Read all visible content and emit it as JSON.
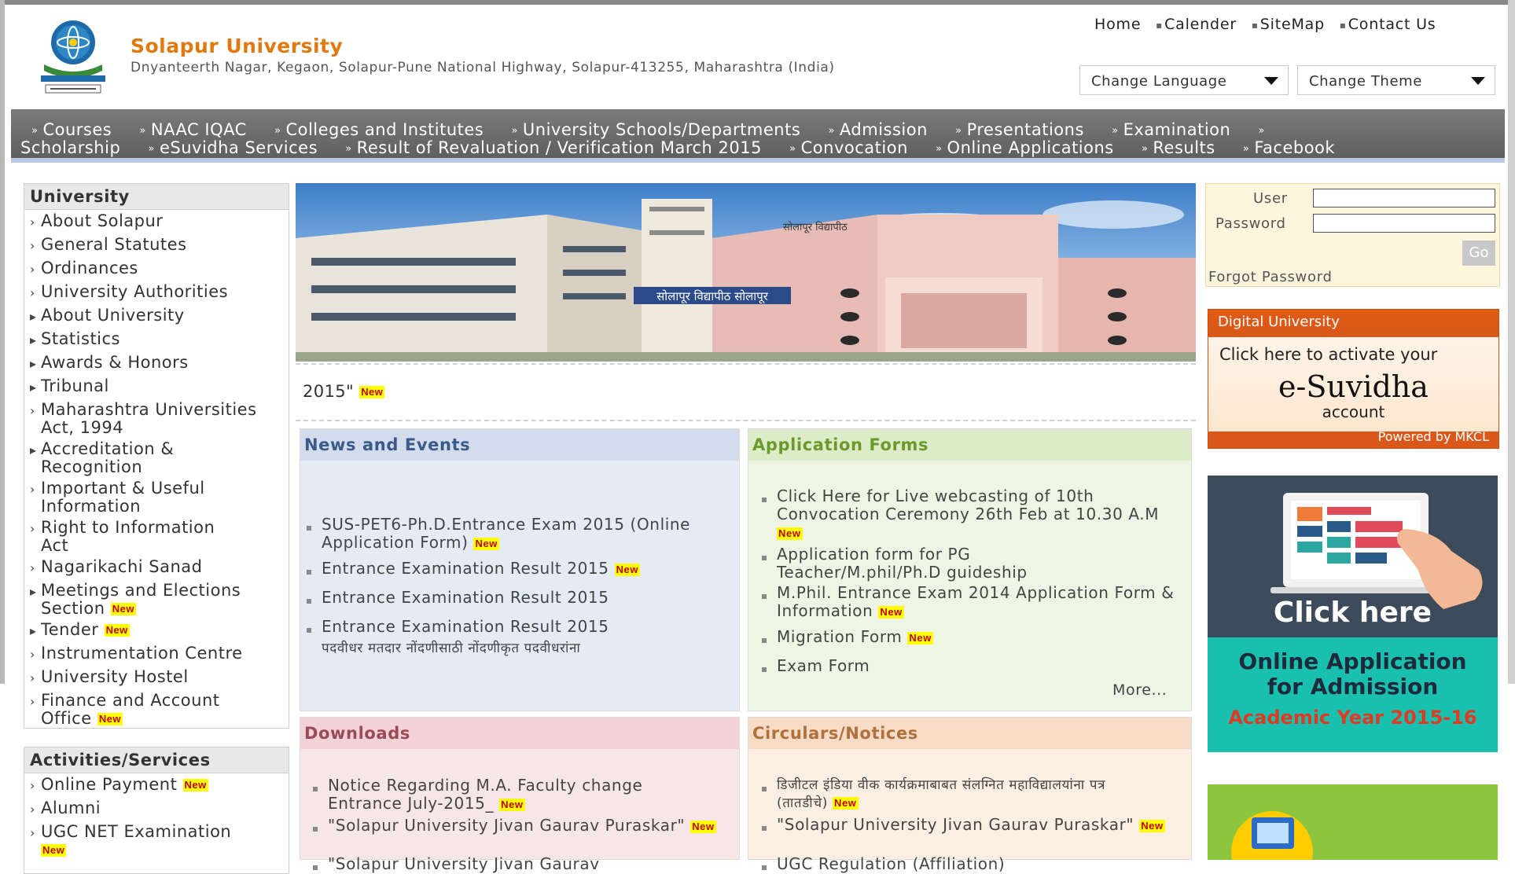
{
  "header": {
    "title": "Solapur University",
    "address": "Dnyanteerth Nagar, Kegaon, Solapur-Pune National Highway, Solapur-413255, Maharashtra (India)",
    "top_links": [
      "Home",
      "Calender",
      "SiteMap",
      "Contact Us"
    ],
    "language_select": "Change Language",
    "theme_select": "Change Theme"
  },
  "nav": {
    "row1": [
      "Courses",
      "NAAC IQAC",
      "Colleges and Institutes",
      "University Schools/Departments",
      "Admission",
      "Presentations",
      "Examination"
    ],
    "row1_tail": "Scholarship",
    "row2": [
      "eSuvidha Services",
      "Result of Revaluation / Verification March 2015",
      "Convocation",
      "Online Applications",
      "Results",
      "Facebook"
    ]
  },
  "sidebar_university": {
    "heading": "University",
    "items": [
      {
        "label": "About Solapur",
        "marker": "›"
      },
      {
        "label": "General Statutes",
        "marker": "›"
      },
      {
        "label": "Ordinances",
        "marker": "›"
      },
      {
        "label": "University Authorities",
        "marker": "›"
      },
      {
        "label": "About University",
        "marker": "▸"
      },
      {
        "label": "Statistics",
        "marker": "▸"
      },
      {
        "label": "Awards & Honors",
        "marker": "▸"
      },
      {
        "label": "Tribunal",
        "marker": "▸"
      },
      {
        "label": "Maharashtra Universities Act, 1994",
        "marker": "›"
      },
      {
        "label": "Accreditation & Recognition",
        "marker": "▸"
      },
      {
        "label": "Important & Useful Information",
        "marker": "›"
      },
      {
        "label": "Right to Information Act",
        "marker": "›"
      },
      {
        "label": "Nagarikachi Sanad",
        "marker": "›"
      },
      {
        "label": "Meetings and Elections Section",
        "marker": "▸"
      },
      {
        "label": "Tender",
        "marker": "▸"
      },
      {
        "label": "Instrumentation Centre",
        "marker": "›"
      },
      {
        "label": "University Hostel",
        "marker": "›"
      },
      {
        "label": "Finance and Account Office",
        "marker": "›"
      }
    ]
  },
  "sidebar_services": {
    "heading": "Activities/Services",
    "items": [
      {
        "label": "Online Payment",
        "marker": "›"
      },
      {
        "label": "Alumni",
        "marker": "›"
      },
      {
        "label": "UGC NET Examination",
        "marker": "›"
      }
    ]
  },
  "new_badge": "New",
  "banner": {
    "building_sign": "सोलापूर विद्यापीठ सोलापूर",
    "roof_sign": "सोलापूर विद्यापीठ"
  },
  "marquee": "2015\"",
  "news": {
    "heading": "News and Events",
    "items": [
      "SUS-PET6-Ph.D.Entrance Exam 2015 (Online Application Form)",
      "Entrance Examination Result 2015",
      "Entrance Examination Result 2015",
      "Entrance Examination Result 2015"
    ],
    "trailing": "पदवीधर मतदार नोंदणीसाठी नोंदणीकृत पदवीधरांना"
  },
  "applications": {
    "heading": "Application Forms",
    "items": [
      "Click Here for Live webcasting of 10th Convocation Ceremony 26th Feb at 10.30 A.M",
      "Application form for PG Teacher/M.phil/Ph.D guideship",
      "M.Phil. Entrance Exam 2014 Application Form & Information",
      "Migration Form",
      "Exam Form"
    ],
    "more": "More..."
  },
  "downloads": {
    "heading": "Downloads",
    "items": [
      "Notice Regarding M.A. Faculty change Entrance July-2015_",
      "\"Solapur University Jivan Gaurav Puraskar\"",
      "\"Solapur University Jivan Gaurav"
    ]
  },
  "circulars": {
    "heading": "Circulars/Notices",
    "items": [
      "डिजीटल इंडिया वीक कार्यक्रमाबाबत संलग्नित महाविद्यालयांना पत्र (तातडीचे)",
      "\"Solapur University Jivan Gaurav Puraskar\"",
      "UGC Regulation (Affiliation)"
    ]
  },
  "login": {
    "user_label": "User",
    "password_label": "Password",
    "go": "Go",
    "forgot": "Forgot Password"
  },
  "esuvidha": {
    "brand": "Digital University",
    "line1": "Click here to activate your",
    "name": "e-Suvidha",
    "line3": "account",
    "powered": "Powered by MKCL"
  },
  "admission_ad": {
    "click": "Click here",
    "line1": "Online Application",
    "line2": "for Admission",
    "line3": "Academic Year 2015-16"
  },
  "colors": {
    "brand_orange": "#e07a10",
    "nav_gray": "#6b6b6b",
    "news_bg": "#e4ebf5",
    "app_bg": "#eef5e4",
    "downloads_bg": "#f7e6e8",
    "circulars_bg": "#fbeee2",
    "admission_teal": "#19c0b0",
    "admission_red": "#e03a22"
  }
}
